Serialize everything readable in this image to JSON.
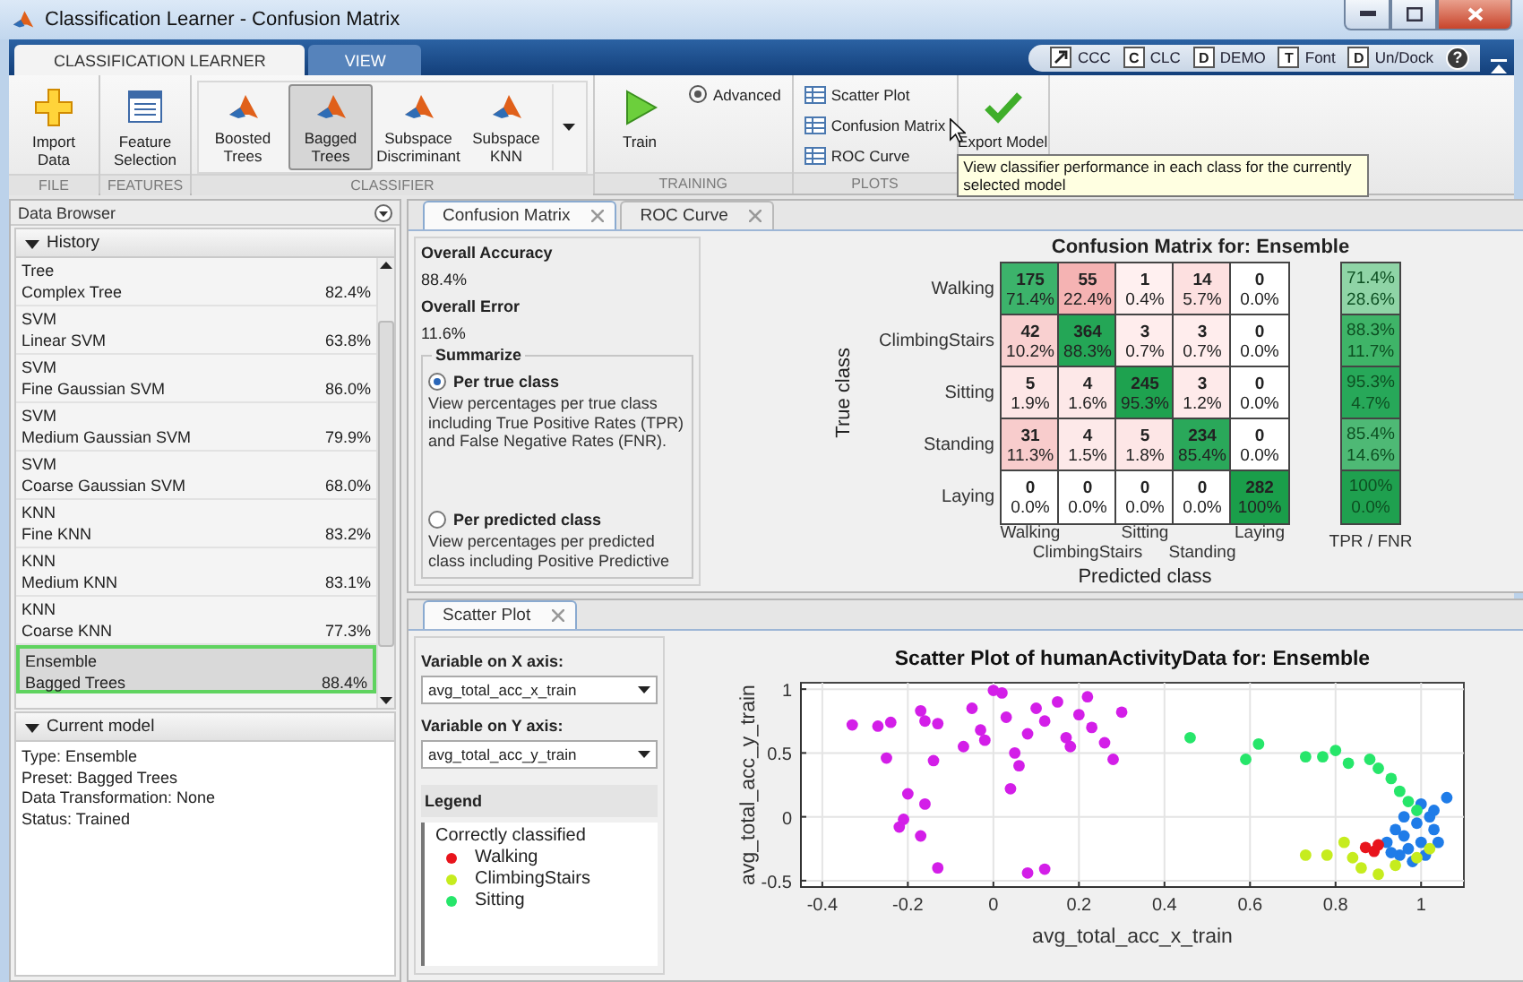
{
  "window": {
    "title": "Classification Learner - Confusion Matrix"
  },
  "ribbon_tabs": [
    {
      "label": "CLASSIFICATION LEARNER",
      "selected": true
    },
    {
      "label": "VIEW",
      "selected": false
    }
  ],
  "quick_access": [
    {
      "kind": "arrow",
      "label": "CCC"
    },
    {
      "kind": "letter",
      "key": "C",
      "label": "CLC"
    },
    {
      "kind": "letter",
      "key": "D",
      "label": "DEMO"
    },
    {
      "kind": "letter",
      "key": "T",
      "label": "Font"
    },
    {
      "kind": "letter",
      "key": "D",
      "label": "Un/Dock"
    }
  ],
  "help": "?",
  "ribbon_groups": [
    {
      "label": "FILE",
      "items": [
        {
          "kind": "large",
          "label": "Import Data"
        }
      ]
    },
    {
      "label": "FEATURES",
      "items": [
        {
          "kind": "large",
          "label": "Feature Selection"
        }
      ]
    },
    {
      "label": "CLASSIFIER",
      "items": [
        {
          "kind": "gallery",
          "label": "Boosted Trees",
          "selected": false
        },
        {
          "kind": "gallery",
          "label": "Bagged Trees",
          "selected": true
        },
        {
          "kind": "gallery",
          "label": "Subspace Discriminant",
          "selected": false
        },
        {
          "kind": "gallery",
          "label": "Subspace KNN",
          "selected": false
        },
        {
          "kind": "more"
        }
      ]
    },
    {
      "label": "TRAINING",
      "items": [
        {
          "kind": "large",
          "label": "Train"
        },
        {
          "kind": "small",
          "label": "Advanced"
        }
      ]
    },
    {
      "label": "PLOTS",
      "items": [
        {
          "kind": "small",
          "label": "Scatter Plot"
        },
        {
          "kind": "small",
          "label": "Confusion Matrix"
        },
        {
          "kind": "small",
          "label": "ROC Curve"
        }
      ]
    },
    {
      "items": [
        {
          "kind": "large",
          "label": "Export Model"
        }
      ]
    }
  ],
  "tooltip": "View classifier performance in each class for the currently selected model",
  "data_browser": {
    "title": "Data Browser",
    "history": {
      "title": "History",
      "expanded": true,
      "items": [
        {
          "type": "Tree",
          "name": "Complex Tree",
          "accuracy": "82.4%",
          "selected": false
        },
        {
          "type": "SVM",
          "name": "Linear SVM",
          "accuracy": "63.8%",
          "selected": false
        },
        {
          "type": "SVM",
          "name": "Fine Gaussian SVM",
          "accuracy": "86.0%",
          "selected": false
        },
        {
          "type": "SVM",
          "name": "Medium Gaussian SVM",
          "accuracy": "79.9%",
          "selected": false
        },
        {
          "type": "SVM",
          "name": "Coarse Gaussian SVM",
          "accuracy": "68.0%",
          "selected": false
        },
        {
          "type": "KNN",
          "name": "Fine KNN",
          "accuracy": "83.2%",
          "selected": false
        },
        {
          "type": "KNN",
          "name": "Medium KNN",
          "accuracy": "83.1%",
          "selected": false
        },
        {
          "type": "KNN",
          "name": "Coarse KNN",
          "accuracy": "77.3%",
          "selected": false
        },
        {
          "type": "Ensemble",
          "name": "Bagged Trees",
          "accuracy": "88.4%",
          "selected": true
        }
      ]
    },
    "current_model": {
      "title": "Current model",
      "expanded": true,
      "lines": [
        "Type: Ensemble",
        "Preset: Bagged Trees",
        "Data Transformation: None",
        "Status: Trained"
      ]
    }
  },
  "confusion_tabs": [
    {
      "label": "Confusion Matrix",
      "selected": true
    },
    {
      "label": "ROC Curve",
      "selected": false
    }
  ],
  "summary": {
    "accuracy_label": "Overall Accuracy",
    "accuracy": "88.4%",
    "error_label": "Overall Error",
    "error": "11.6%",
    "summarize": {
      "title": "Summarize",
      "options": [
        {
          "label": "Per true class",
          "description": "View percentages per true class including True Positive Rates (TPR) and False Negative Rates (FNR).",
          "selected": true
        },
        {
          "label": "Per predicted class",
          "description": "View percentages per predicted class including Positive Predictive",
          "selected": false
        }
      ]
    }
  },
  "confusion_matrix": {
    "title": "Confusion Matrix for: Ensemble",
    "ylabel": "True class",
    "xlabel": "Predicted class",
    "rate_label": "TPR / FNR",
    "rows": [
      {
        "label": "Walking",
        "cells": [
          {
            "count": "175",
            "percent": "71.4%",
            "color": "#3cb36b"
          },
          {
            "count": "55",
            "percent": "22.4%",
            "color": "#f5b3b3"
          },
          {
            "count": "1",
            "percent": "0.4%",
            "color": "#fff0f0"
          },
          {
            "count": "14",
            "percent": "5.7%",
            "color": "#fde0e0"
          },
          {
            "count": "0",
            "percent": "0.0%",
            "color": "#ffffff"
          }
        ],
        "rate": {
          "tpr": "71.4%",
          "fnr": "28.6%",
          "color": "#8fd4a6"
        }
      },
      {
        "label": "ClimbingStairs",
        "cells": [
          {
            "count": "42",
            "percent": "10.2%",
            "color": "#f9d0d0"
          },
          {
            "count": "364",
            "percent": "88.3%",
            "color": "#24a656"
          },
          {
            "count": "3",
            "percent": "0.7%",
            "color": "#ffeded"
          },
          {
            "count": "3",
            "percent": "0.7%",
            "color": "#ffeded"
          },
          {
            "count": "0",
            "percent": "0.0%",
            "color": "#ffffff"
          }
        ],
        "rate": {
          "tpr": "88.3%",
          "fnr": "11.7%",
          "color": "#3fb468"
        }
      },
      {
        "label": "Sitting",
        "cells": [
          {
            "count": "5",
            "percent": "1.9%",
            "color": "#fde6e6"
          },
          {
            "count": "4",
            "percent": "1.6%",
            "color": "#fde8e8"
          },
          {
            "count": "245",
            "percent": "95.3%",
            "color": "#1ea24f"
          },
          {
            "count": "3",
            "percent": "1.2%",
            "color": "#feeaea"
          },
          {
            "count": "0",
            "percent": "0.0%",
            "color": "#ffffff"
          }
        ],
        "rate": {
          "tpr": "95.3%",
          "fnr": "4.7%",
          "color": "#27a859"
        }
      },
      {
        "label": "Standing",
        "cells": [
          {
            "count": "31",
            "percent": "11.3%",
            "color": "#f8cccc"
          },
          {
            "count": "4",
            "percent": "1.5%",
            "color": "#fde9e9"
          },
          {
            "count": "5",
            "percent": "1.8%",
            "color": "#fde6e6"
          },
          {
            "count": "234",
            "percent": "85.4%",
            "color": "#2aa85a"
          },
          {
            "count": "0",
            "percent": "0.0%",
            "color": "#ffffff"
          }
        ],
        "rate": {
          "tpr": "85.4%",
          "fnr": "14.6%",
          "color": "#4eb975"
        }
      },
      {
        "label": "Laying",
        "cells": [
          {
            "count": "0",
            "percent": "0.0%",
            "color": "#ffffff"
          },
          {
            "count": "0",
            "percent": "0.0%",
            "color": "#ffffff"
          },
          {
            "count": "0",
            "percent": "0.0%",
            "color": "#ffffff"
          },
          {
            "count": "0",
            "percent": "0.0%",
            "color": "#ffffff"
          },
          {
            "count": "282",
            "percent": "100%",
            "color": "#1a9e4a"
          }
        ],
        "rate": {
          "tpr": "100%",
          "fnr": "0.0%",
          "color": "#1fa04f"
        }
      }
    ],
    "column_labels": [
      "Walking",
      "ClimbingStairs",
      "Sitting",
      "Standing",
      "Laying"
    ]
  },
  "scatter": {
    "tabs": [
      {
        "label": "Scatter Plot",
        "selected": true
      }
    ],
    "x_variable": {
      "label": "Variable on X axis:",
      "value": "avg_total_acc_x_train"
    },
    "y_variable": {
      "label": "Variable on Y axis:",
      "value": "avg_total_acc_y_train"
    },
    "legend": {
      "title": "Legend",
      "heading": "Correctly classified"
    },
    "chart_data": {
      "type": "scatter",
      "grid": true,
      "title": "Scatter Plot of humanActivityData for: Ensemble",
      "xlabel": "avg_total_acc_x_train",
      "ylabel": "avg_total_acc_y_train",
      "xlim": [
        -0.45,
        1.1
      ],
      "ylim": [
        -0.55,
        1.05
      ],
      "xticks": [
        -0.4,
        -0.2,
        0,
        0.2,
        0.4,
        0.6,
        0.8,
        1
      ],
      "yticks": [
        -0.5,
        0,
        0.5,
        1
      ],
      "series": [
        {
          "color": "#d31ee8",
          "x": [
            -0.33,
            -0.27,
            -0.24,
            -0.25,
            -0.17,
            -0.16,
            -0.13,
            -0.14,
            -0.2,
            -0.21,
            -0.22,
            -0.17,
            -0.16,
            -0.13,
            -0.05,
            -0.03,
            -0.02,
            0,
            0.02,
            0.03,
            0.05,
            0.06,
            0.04,
            0.08,
            0.1,
            0.12,
            0.15,
            0.17,
            0.2,
            0.22,
            0.23,
            0.26,
            0.28,
            0.3,
            0.08,
            0.12,
            -0.07,
            0.18
          ],
          "values": [
            0.72,
            0.71,
            0.74,
            0.46,
            0.83,
            0.75,
            0.73,
            0.44,
            0.18,
            -0.02,
            -0.08,
            -0.15,
            0.1,
            -0.4,
            0.85,
            0.68,
            0.6,
            0.99,
            0.97,
            0.78,
            0.5,
            0.4,
            0.22,
            0.65,
            0.85,
            0.75,
            0.9,
            0.62,
            0.8,
            0.94,
            0.7,
            0.58,
            0.45,
            0.82,
            -0.44,
            -0.41,
            0.55,
            0.55
          ]
        },
        {
          "color": "#1f7ce8",
          "x": [
            0.92,
            0.94,
            0.96,
            1.06,
            1.0,
            1.02,
            1.03,
            1.0,
            0.97,
            0.95,
            1.01,
            1.04,
            0.99,
            0.96,
            0.98,
            1.03,
            0.93
          ],
          "values": [
            -0.2,
            -0.1,
            0,
            0.15,
            0.1,
            0,
            -0.1,
            -0.2,
            -0.25,
            -0.3,
            -0.3,
            -0.2,
            -0.05,
            -0.15,
            -0.35,
            0.05,
            -0.28
          ]
        },
        {
          "name": "Walking",
          "color": "#e8141c",
          "x": [
            0.87,
            0.89,
            0.9
          ],
          "values": [
            -0.24,
            -0.27,
            -0.22
          ]
        },
        {
          "name": "ClimbingStairs",
          "color": "#c6ec1e",
          "x": [
            0.73,
            0.78,
            0.82,
            0.84,
            0.86,
            0.9,
            0.94,
            0.99,
            1.02
          ],
          "values": [
            -0.3,
            -0.3,
            -0.2,
            -0.32,
            -0.4,
            -0.45,
            -0.38,
            -0.32,
            -0.25
          ]
        },
        {
          "name": "Sitting",
          "color": "#26e66a",
          "x": [
            0.46,
            0.59,
            0.62,
            0.73,
            0.77,
            0.8,
            0.83,
            0.88,
            0.9,
            0.93,
            0.95,
            0.97,
            0.99
          ],
          "values": [
            0.62,
            0.45,
            0.57,
            0.47,
            0.47,
            0.52,
            0.42,
            0.45,
            0.38,
            0.3,
            0.2,
            0.12,
            0.05
          ]
        }
      ]
    }
  }
}
